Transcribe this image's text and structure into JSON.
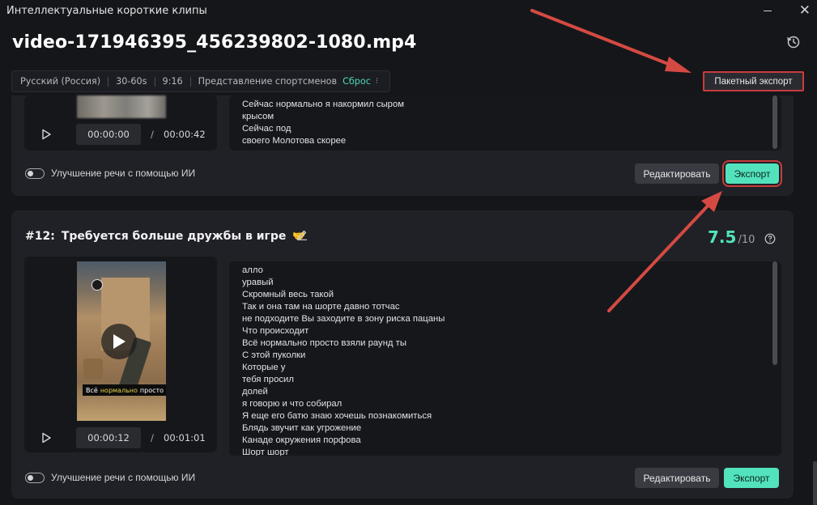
{
  "window": {
    "title": "Интеллектуальные короткие клипы",
    "close_glyph": "✕"
  },
  "header": {
    "filename": "video-171946395_456239802-1080.mp4"
  },
  "filters": {
    "language": "Русский (Россия)",
    "duration": "30-60s",
    "aspect": "9:16",
    "theme": "Представление спортсменов",
    "reset_label": "Сброс",
    "reset_chevron": "⁝"
  },
  "batch_export_label": "Пакетный экспорт",
  "clips": [
    {
      "transcript": [
        "Сейчас нормально я накормил сыром",
        "крысом",
        "Сейчас под",
        "своего Молотова скорее"
      ],
      "current_time": "00:00:00",
      "slash": "/",
      "total_time": "00:00:42",
      "speech_toggle_label": "Улучшение речи с помощью ИИ",
      "edit_label": "Редактировать",
      "export_label": "Экспорт"
    },
    {
      "number": "#12:",
      "title": "Требуется больше дружбы в игре",
      "emoji": "🤝",
      "score": "7.5",
      "score_max": "/10",
      "thumbnail_caption": {
        "w1": "Всё",
        "w2": "нормально",
        "w3": "просто"
      },
      "transcript": [
        "алло",
        "уравый",
        "Скромный весь такой",
        "Так и она там на шорте давно тотчас",
        "не подходите Вы заходите в зону риска пацаны",
        "Что происходит",
        "Всё нормально просто взяли раунд ты",
        "С этой пуколки",
        "Которые у",
        "тебя просил",
        "долей",
        "я говорю и что собирал",
        "Я еще его батю знаю хочешь познакомиться",
        "Блядь звучит как угрожение",
        "Канаде окружения порфова",
        "Шорт шорт"
      ],
      "current_time": "00:00:12",
      "slash": "/",
      "total_time": "00:01:01",
      "speech_toggle_label": "Улучшение речи с помощью ИИ",
      "edit_label": "Редактировать",
      "export_label": "Экспорт"
    }
  ],
  "colors": {
    "accent": "#52e3bd",
    "annotation_red": "#c83c3c",
    "background": "#15161a",
    "card": "#202126"
  },
  "icons": [
    "history-icon",
    "play-icon",
    "pencil-icon",
    "help-icon",
    "close-icon"
  ]
}
